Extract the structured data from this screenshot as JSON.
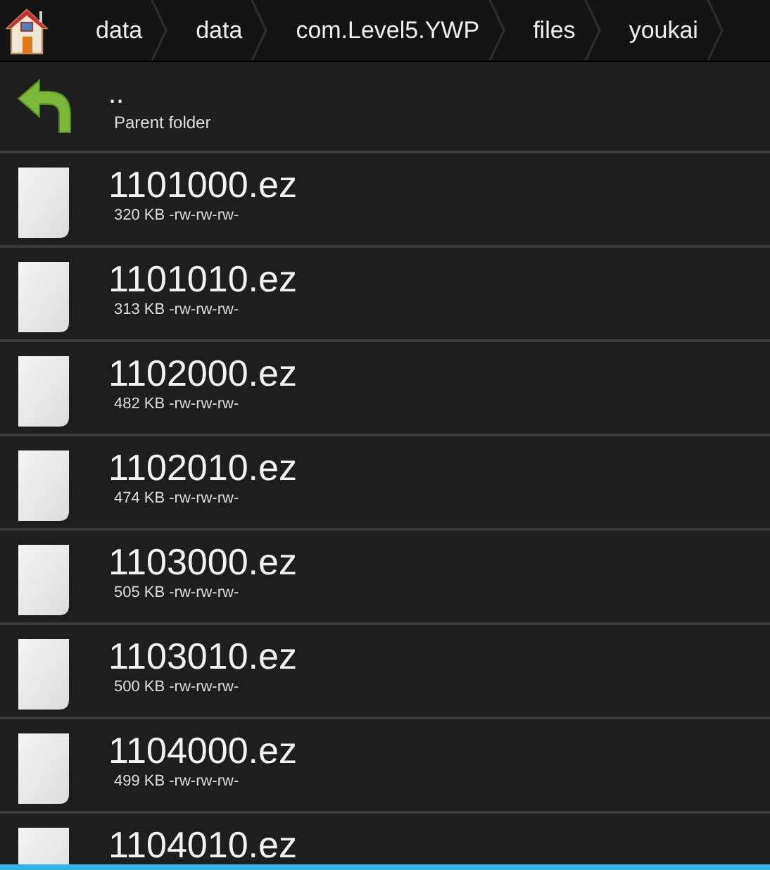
{
  "breadcrumbs": [
    {
      "label": "data"
    },
    {
      "label": "data"
    },
    {
      "label": "com.Level5.YWP"
    },
    {
      "label": "files"
    },
    {
      "label": "youkai"
    }
  ],
  "parent": {
    "name": "..",
    "detail": "Parent folder"
  },
  "files": [
    {
      "name": "1101000.ez",
      "detail": "320 KB -rw-rw-rw-"
    },
    {
      "name": "1101010.ez",
      "detail": "313 KB -rw-rw-rw-"
    },
    {
      "name": "1102000.ez",
      "detail": "482 KB -rw-rw-rw-"
    },
    {
      "name": "1102010.ez",
      "detail": "474 KB -rw-rw-rw-"
    },
    {
      "name": "1103000.ez",
      "detail": "505 KB -rw-rw-rw-"
    },
    {
      "name": "1103010.ez",
      "detail": "500 KB -rw-rw-rw-"
    },
    {
      "name": "1104000.ez",
      "detail": "499 KB -rw-rw-rw-"
    },
    {
      "name": "1104010.ez"
    }
  ]
}
